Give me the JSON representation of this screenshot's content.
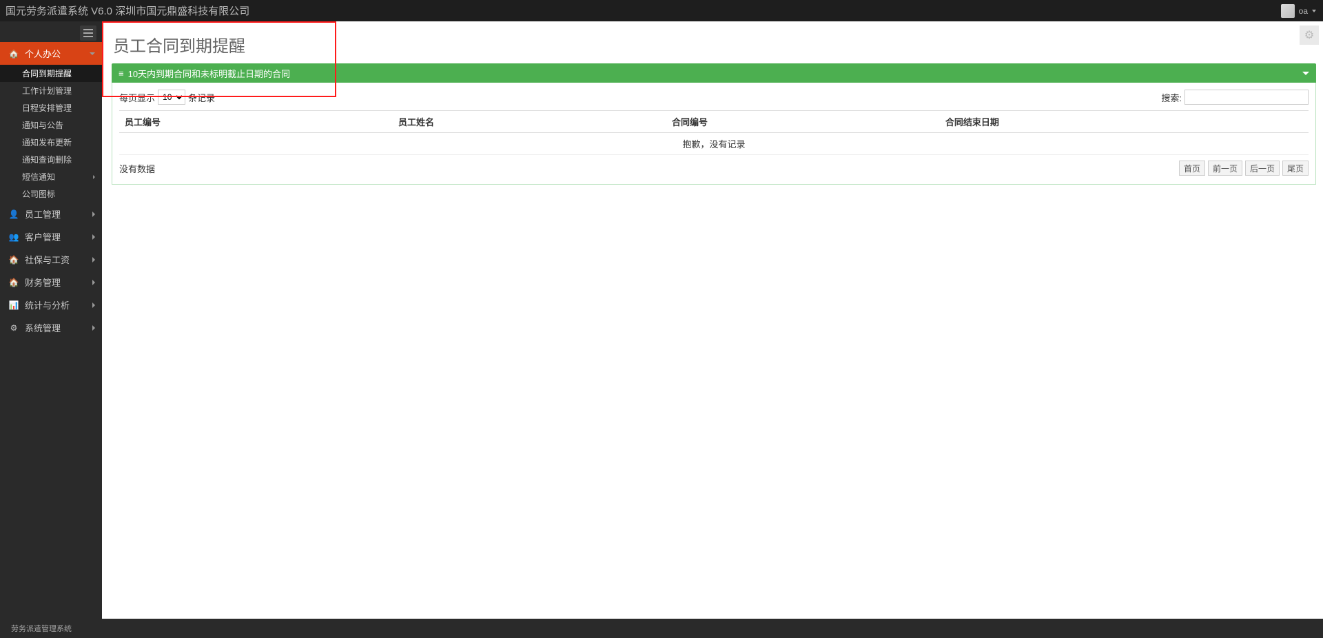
{
  "app_title": "国元劳务派遣系统 V6.0   深圳市国元鼎盛科技有限公司",
  "user": {
    "name": "oa"
  },
  "sidebar": {
    "items": [
      {
        "key": "personal",
        "icon": "🏠",
        "label": "个人办公",
        "active": true,
        "has_submenu": true,
        "children": [
          {
            "key": "contract",
            "label": "合同到期提醒",
            "selected": true
          },
          {
            "key": "workplan",
            "label": "工作计划管理"
          },
          {
            "key": "schedule",
            "label": "日程安排管理"
          },
          {
            "key": "notice",
            "label": "通知与公告"
          },
          {
            "key": "noticepub",
            "label": "通知发布更新"
          },
          {
            "key": "noticedel",
            "label": "通知查询删除"
          },
          {
            "key": "sms",
            "label": "短信通知",
            "has_submenu": true
          },
          {
            "key": "logo",
            "label": "公司图标"
          }
        ]
      },
      {
        "key": "employee",
        "icon": "👤",
        "label": "员工管理",
        "has_submenu": true
      },
      {
        "key": "customer",
        "icon": "👥",
        "label": "客户管理",
        "has_submenu": true
      },
      {
        "key": "social",
        "icon": "🏠",
        "label": "社保与工资",
        "has_submenu": true
      },
      {
        "key": "finance",
        "icon": "🏠",
        "label": "财务管理",
        "has_submenu": true
      },
      {
        "key": "stats",
        "icon": "📊",
        "label": "统计与分析",
        "has_submenu": true
      },
      {
        "key": "system",
        "icon": "⚙",
        "label": "系统管理",
        "has_submenu": true
      }
    ]
  },
  "page": {
    "title": "员工合同到期提醒",
    "section_title": "10天内到期合同和未标明截止日期的合同",
    "per_page_prefix": "每页显示",
    "per_page_suffix": "条记录",
    "per_page_value": "10",
    "search_label": "搜索:",
    "columns": [
      "员工编号",
      "员工姓名",
      "合同编号",
      "合同结束日期"
    ],
    "empty_row": "抱歉，没有记录",
    "no_data": "没有数据",
    "pager": {
      "first": "首页",
      "prev": "前一页",
      "next": "后一页",
      "last": "尾页"
    }
  },
  "footer": "劳务派遣管理系统"
}
